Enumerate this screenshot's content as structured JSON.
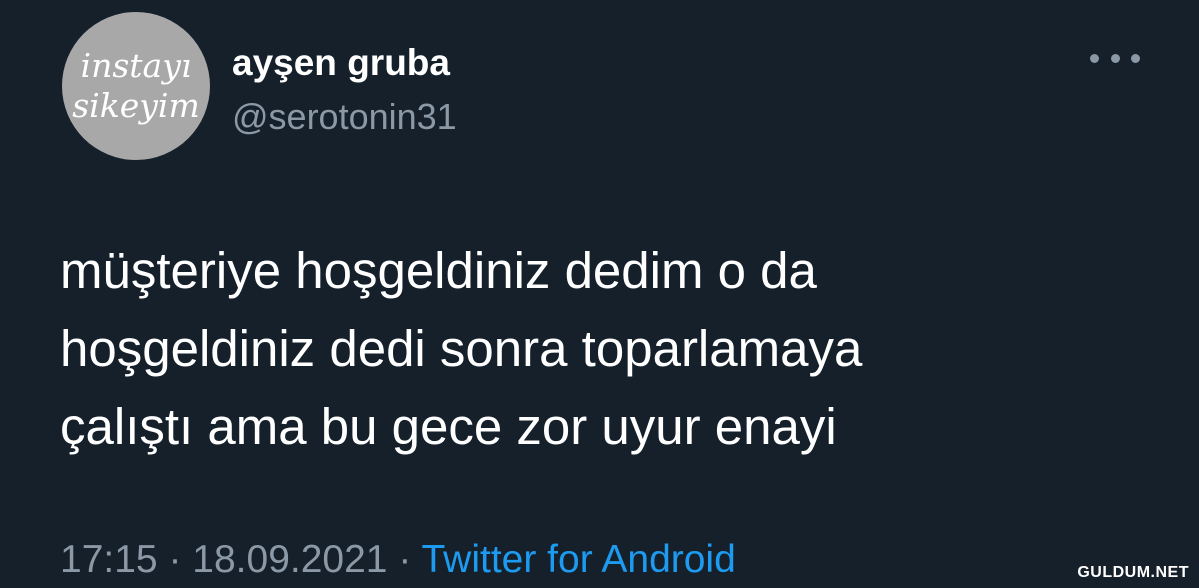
{
  "user": {
    "avatar_text": [
      "instayı",
      "sikeyim"
    ],
    "display_name": "ayşen gruba",
    "handle": "@serotonin31"
  },
  "menu": {
    "icon": "more-horizontal-icon"
  },
  "tweet": {
    "lines": [
      "müşteriye hoşgeldiniz dedim o da",
      "hoşgeldiniz dedi sonra toparlamaya",
      "çalıştı ama bu gece zor uyur enayi"
    ]
  },
  "meta": {
    "time": "17:15",
    "separator": "·",
    "date": "18.09.2021",
    "source": "Twitter for Android"
  },
  "watermark": "GULDUM.NET",
  "colors": {
    "background": "#15202b",
    "secondary_text": "#8b98a5",
    "link": "#1d9bf0",
    "avatar_bg": "#a8a8a8"
  }
}
